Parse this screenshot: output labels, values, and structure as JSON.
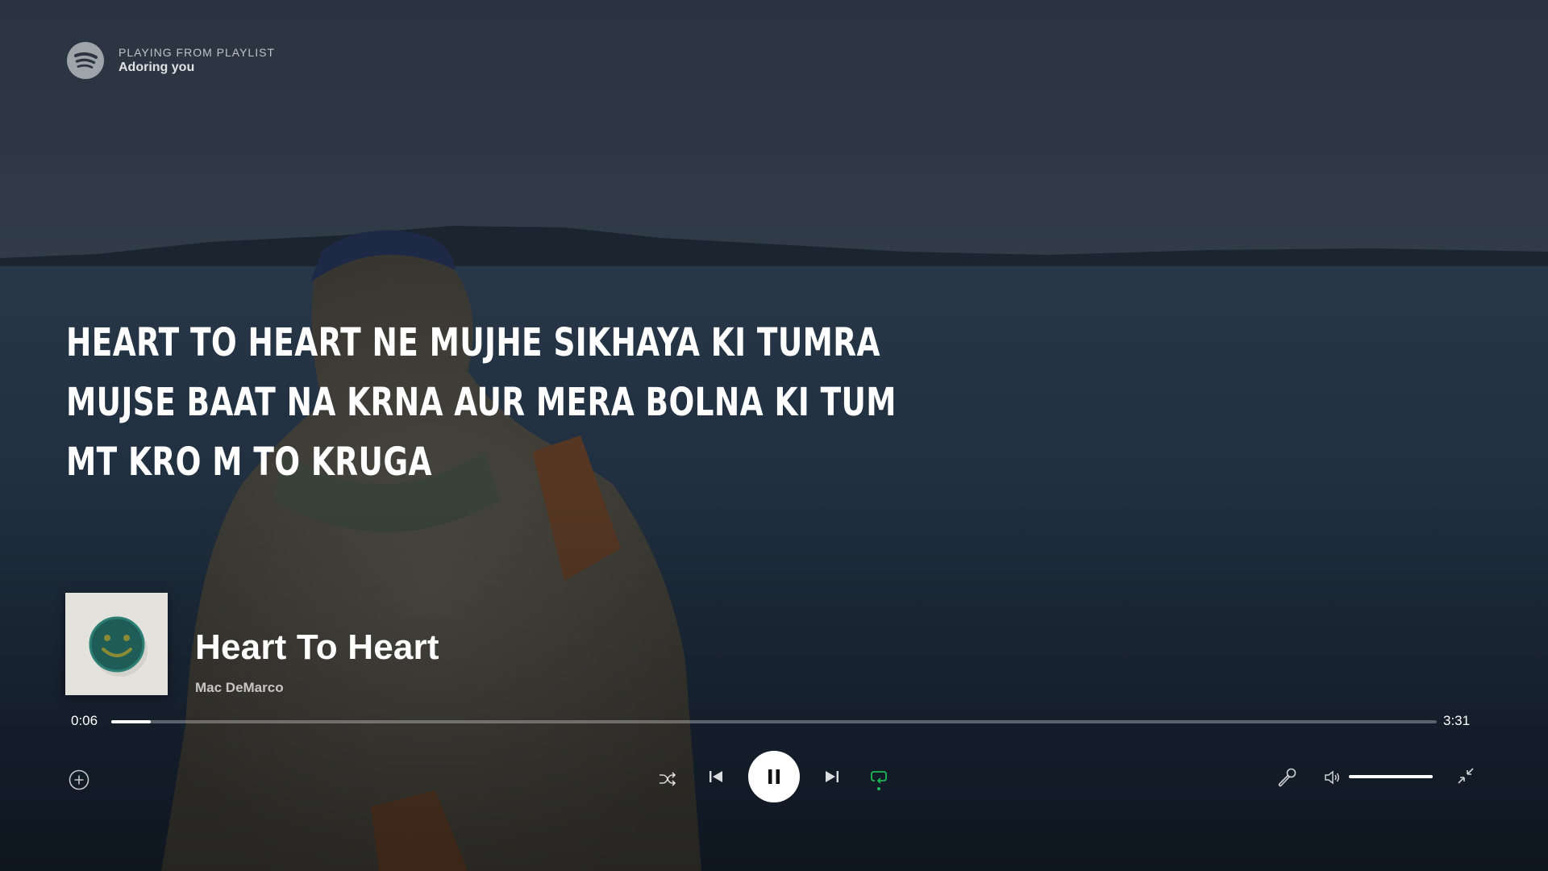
{
  "header": {
    "context_label": "PLAYING FROM PLAYLIST",
    "context_name": "Adoring you",
    "logo_icon": "spotify-logo-icon"
  },
  "lyrics": {
    "lines": [
      "HEART TO HEART NE MUJHE SIKHAYA KI TUMRA",
      "MUJSE BAAT NA KRNA AUR MERA BOLNA KI TUM",
      "MT KRO M TO KRUGA"
    ]
  },
  "track": {
    "title": "Heart To Heart",
    "artist": "Mac DeMarco",
    "cover_icon": "smiley-face-cover-art"
  },
  "playback": {
    "elapsed": "0:06",
    "total": "3:31",
    "progress_fraction": 0.03,
    "volume_fraction": 1.0,
    "state": "playing"
  },
  "controls": {
    "add_icon": "plus-circle-icon",
    "shuffle_icon": "shuffle-icon",
    "previous_icon": "skip-back-icon",
    "pause_icon": "pause-icon",
    "next_icon": "skip-forward-icon",
    "repeat_icon": "repeat-icon",
    "lyrics_icon": "microphone-icon",
    "volume_icon": "speaker-icon",
    "exit_fullscreen_icon": "minimize-icon"
  },
  "colors": {
    "accent": "#1db954",
    "text": "#ffffff",
    "play_button": "#ffffff"
  }
}
